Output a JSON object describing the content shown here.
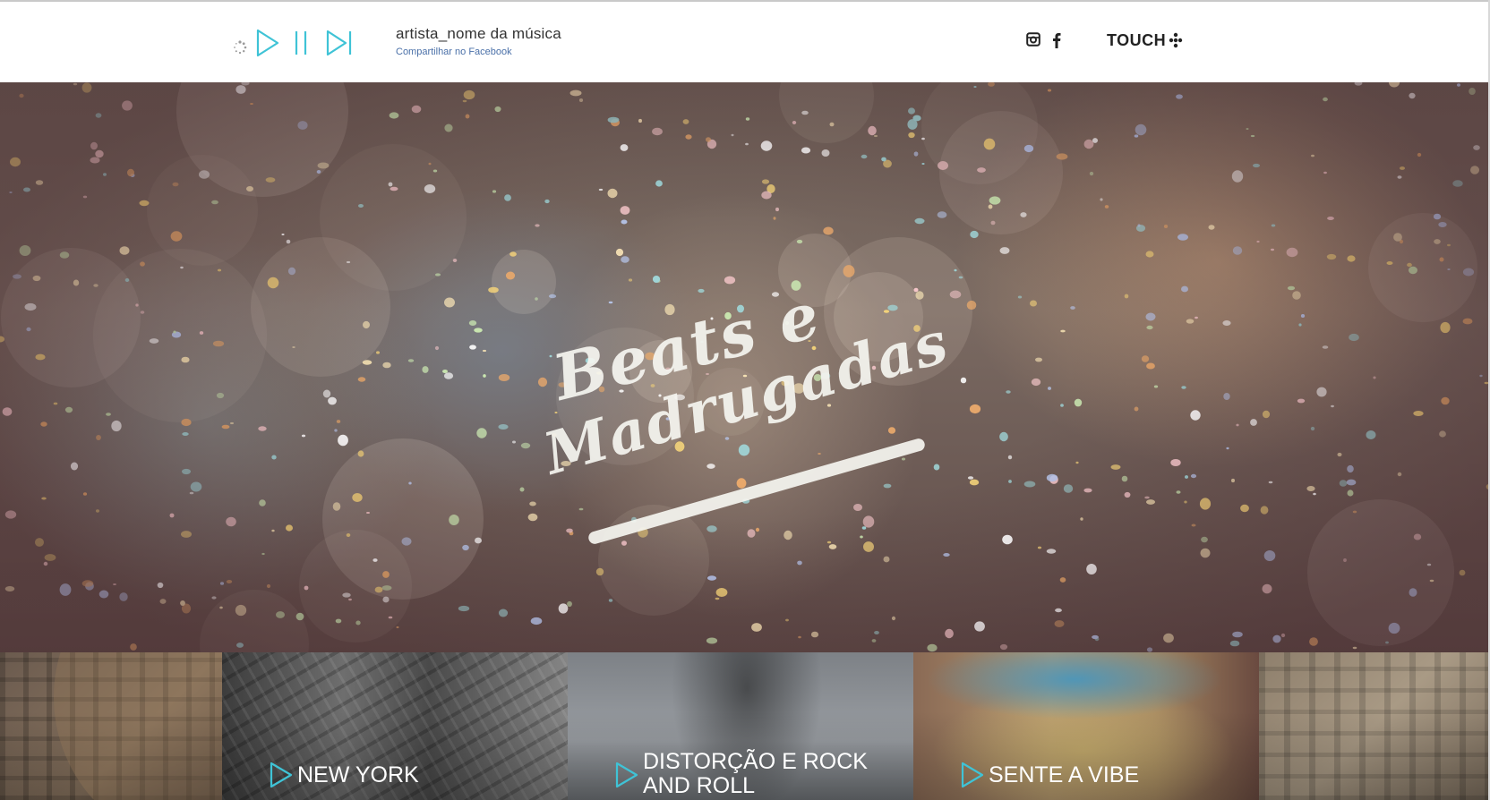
{
  "player": {
    "loader_icon": "loading-spinner-icon",
    "play_icon": "play-icon",
    "pause_icon": "pause-icon",
    "next_icon": "skip-next-icon",
    "accent_color": "#3fc3d6"
  },
  "track": {
    "title": "artista_nome da música",
    "share_link": "Compartilhar no Facebook"
  },
  "social": {
    "instagram_icon": "instagram-icon",
    "facebook_icon": "facebook-icon"
  },
  "brand": {
    "name": "TOUCH",
    "mark_icon": "touch-logo-icon"
  },
  "hero": {
    "title_line1": "Beats e",
    "title_line2": "Madrugadas"
  },
  "categories": [
    {
      "label": "NEW YORK"
    },
    {
      "label": "DISTORÇÃO E ROCK AND ROLL"
    },
    {
      "label": "SENTE A VIBE"
    }
  ]
}
